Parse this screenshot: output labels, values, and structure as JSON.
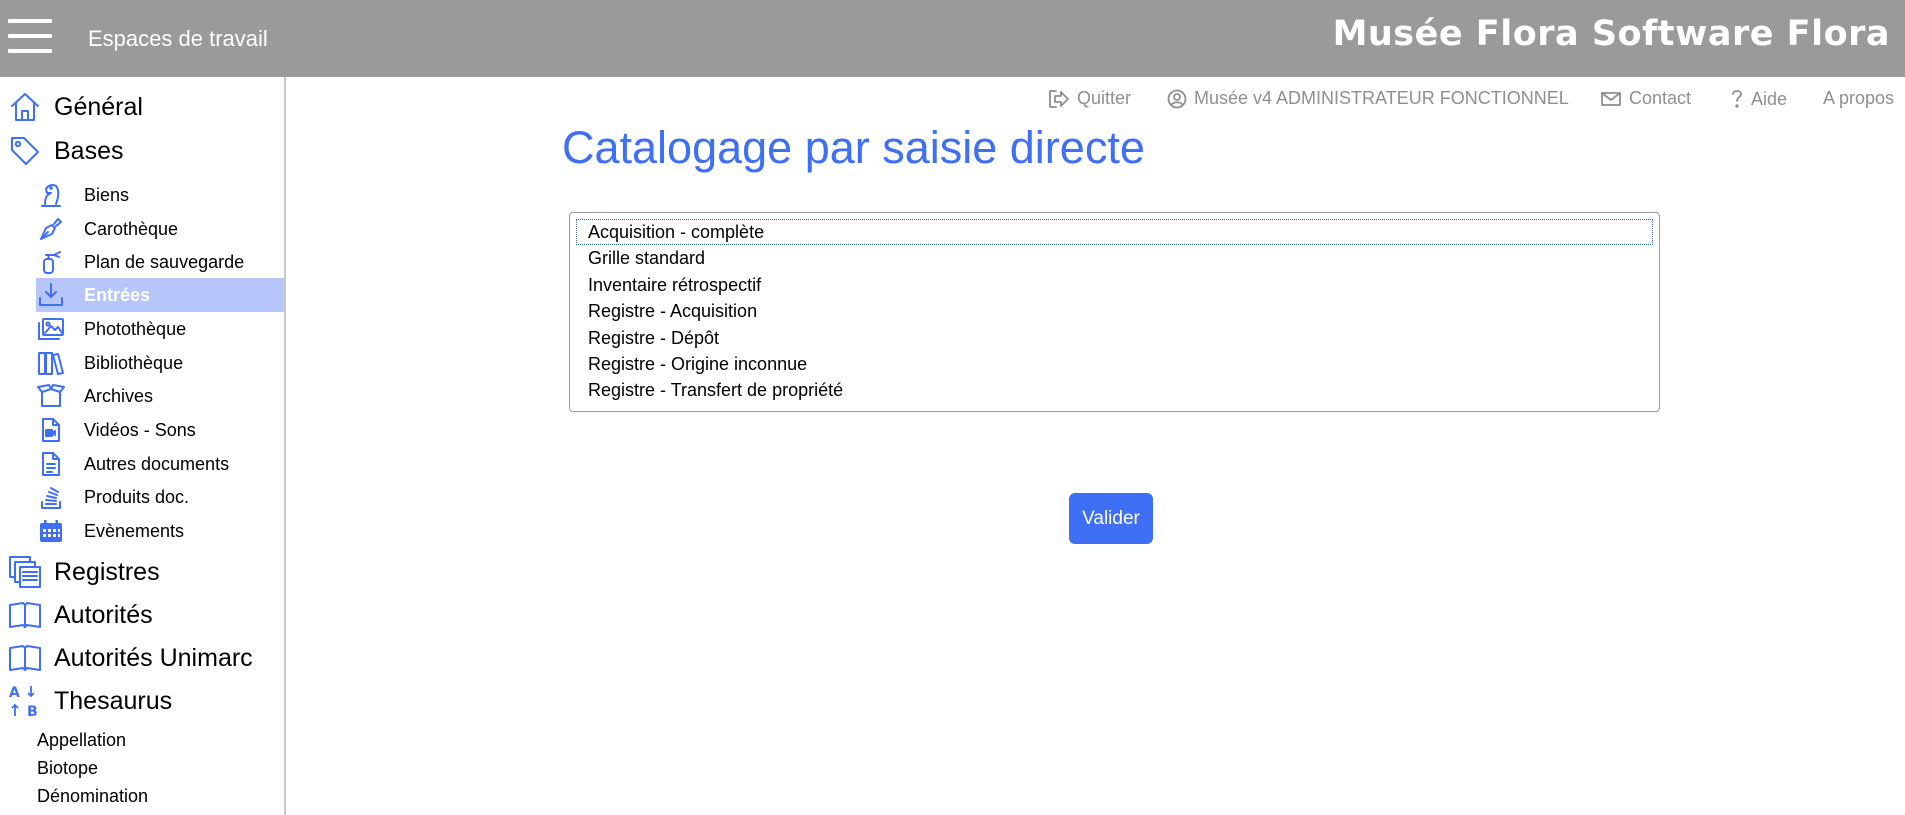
{
  "header": {
    "workspaces_label": "Espaces de travail",
    "brand": "Musée Flora Software Flora"
  },
  "toplinks": {
    "quit": "Quitter",
    "user": "Musée v4 ADMINISTRATEUR FONCTIONNEL",
    "contact": "Contact",
    "help": "Aide",
    "about": "A propos"
  },
  "sidebar": {
    "general": {
      "label": "Général",
      "icon": "home-icon"
    },
    "bases": {
      "label": "Bases",
      "icon": "tag-icon"
    },
    "base_items": [
      {
        "label": "Biens",
        "icon": "chess-knight-icon"
      },
      {
        "label": "Carothèque",
        "icon": "pen-nib-icon"
      },
      {
        "label": "Plan de sauvegarde",
        "icon": "fire-extinguisher-icon"
      },
      {
        "label": "Entrées",
        "icon": "download-tray-icon",
        "active": true
      },
      {
        "label": "Photothèque",
        "icon": "images-icon"
      },
      {
        "label": "Bibliothèque",
        "icon": "books-icon"
      },
      {
        "label": "Archives",
        "icon": "open-box-icon"
      },
      {
        "label": "Vidéos - Sons",
        "icon": "file-video-icon"
      },
      {
        "label": "Autres documents",
        "icon": "file-text-icon"
      },
      {
        "label": "Produits doc.",
        "icon": "stack-icon"
      },
      {
        "label": "Evènements",
        "icon": "calendar-icon"
      }
    ],
    "registres": {
      "label": "Registres",
      "icon": "copy-stack-icon"
    },
    "autorites": {
      "label": "Autorités",
      "icon": "open-book-icon"
    },
    "autorites_unimarc": {
      "label": "Autorités Unimarc",
      "icon": "open-book-icon"
    },
    "thesaurus": {
      "label": "Thesaurus",
      "icon": "sort-alpha-icon"
    },
    "thesaurus_items": [
      "Appellation",
      "Biotope",
      "Dénomination"
    ]
  },
  "main": {
    "title": "Catalogage par saisie directe",
    "options": [
      "Acquisition - complète",
      "Grille standard",
      "Inventaire rétrospectif",
      "Registre - Acquisition",
      "Registre - Dépôt",
      "Registre - Origine inconnue",
      "Registre - Transfert de propriété"
    ],
    "focused_option": "Acquisition - complète",
    "validate_label": "Valider"
  },
  "colors": {
    "accent": "#3f6ff5",
    "header_bg": "#9a9a9a",
    "active_item_bg": "#b6c6fb",
    "link_gray": "#8f8f8f"
  }
}
